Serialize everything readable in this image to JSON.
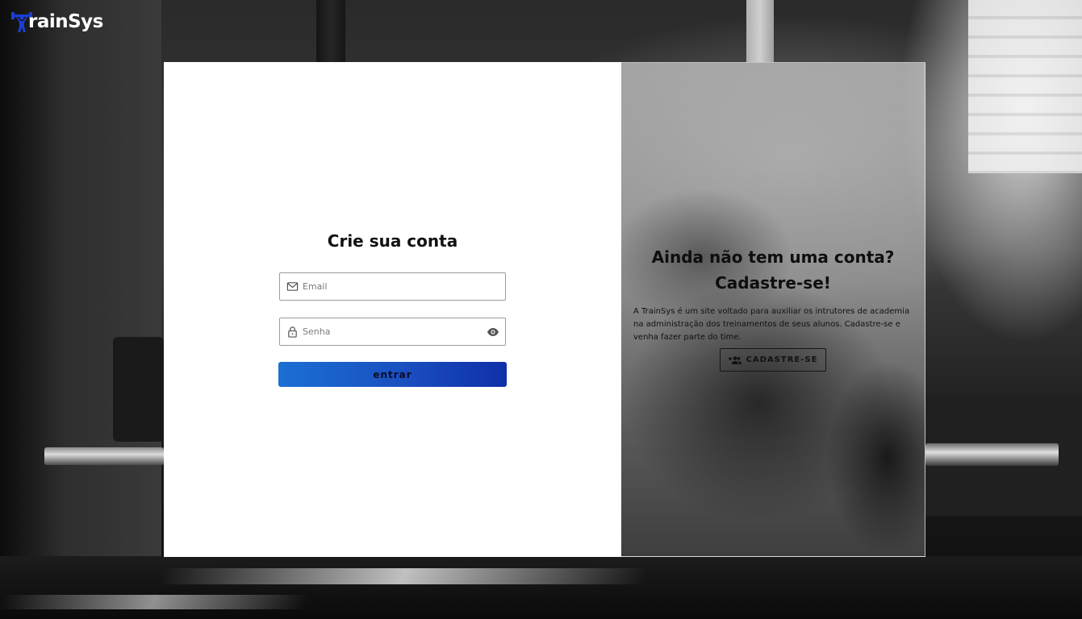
{
  "brand": {
    "name": "TrainSys",
    "logo_text": "rainSys",
    "accent_color": "#1b4fd3"
  },
  "login": {
    "title": "Crie sua conta",
    "email_placeholder": "Email",
    "password_placeholder": "Senha",
    "submit_label": "entrar",
    "icons": [
      "mail-icon",
      "lock-icon",
      "eye-icon"
    ]
  },
  "promo": {
    "title": "Ainda não tem uma conta? Cadastre-se!",
    "text": "A TrainSys é um site voltado para auxiliar os intrutores de academia na administração dos treinamentos de seus alunos. Cadastre-se e venha fazer parte do time.",
    "signup_label": "CADASTRE-SE",
    "signup_icon": "group-add-icon"
  }
}
